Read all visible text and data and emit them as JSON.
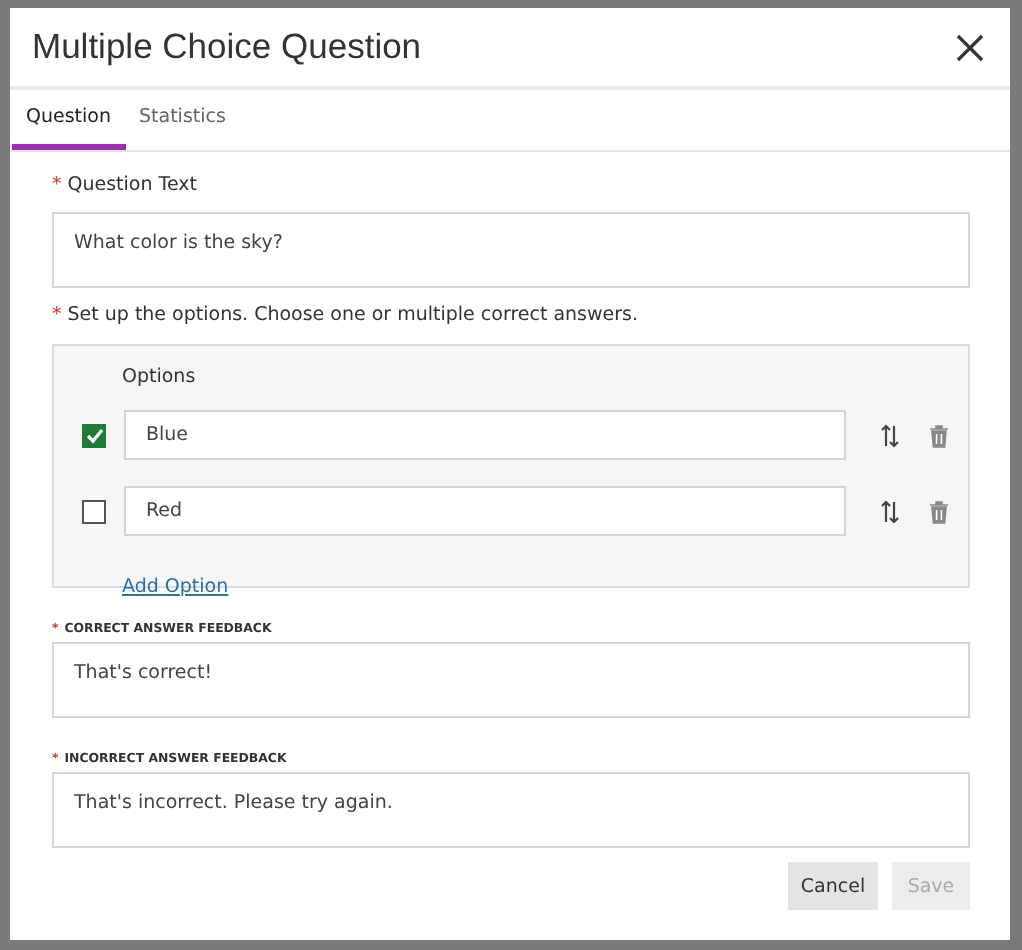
{
  "dialog": {
    "title": "Multiple Choice Question"
  },
  "tabs": [
    {
      "label": "Question",
      "selected": true
    },
    {
      "label": "Statistics",
      "selected": false
    }
  ],
  "question": {
    "mark": "*",
    "label": "Question Text",
    "value": "What color is the sky?"
  },
  "options_section": {
    "mark": "*",
    "instruction": "Set up the options. Choose one or multiple correct answers.",
    "header": "Options",
    "add_link": "Add Option",
    "options": [
      {
        "value": "Blue",
        "checked": true
      },
      {
        "value": "Red",
        "checked": false
      }
    ]
  },
  "feedback": [
    {
      "mark": "*",
      "label": "CORRECT ANSWER FEEDBACK",
      "value": "That's correct!"
    },
    {
      "mark": "*",
      "label": "INCORRECT ANSWER FEEDBACK",
      "value": "That's incorrect. Please try again."
    }
  ],
  "buttons": [
    {
      "label": "Cancel",
      "disabled": false
    },
    {
      "label": "Save",
      "disabled": true
    }
  ]
}
